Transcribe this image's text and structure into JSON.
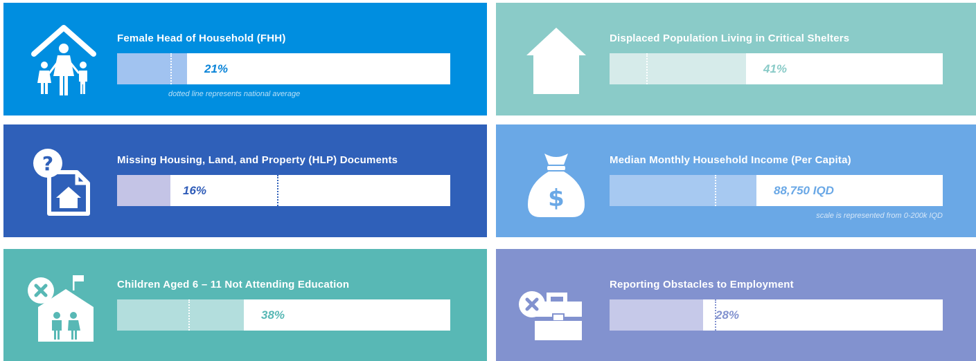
{
  "cards": [
    {
      "title": "Female Head of Household (FHH)",
      "value_label": "21%",
      "value_fraction": 0.21,
      "national_average_fraction": 0.16,
      "note": "dotted line represents national average",
      "icon": "family-home-icon",
      "background": "#008ee0",
      "fill_color": "#a1c3f0",
      "value_color": "#0a84d8"
    },
    {
      "title": "Displaced Population Living in Critical Shelters",
      "value_label": "41%",
      "value_fraction": 0.41,
      "national_average_fraction": 0.11,
      "icon": "house-icon",
      "background": "#8acbc8",
      "fill_color": "#d6ebea",
      "value_color": "#8acbc8"
    },
    {
      "title": "Missing Housing, Land, and Property (HLP) Documents",
      "value_label": "16%",
      "value_fraction": 0.16,
      "national_average_fraction": 0.48,
      "icon": "missing-document-icon",
      "background": "#2f60b9",
      "fill_color": "#c4c4e6",
      "value_color": "#2f5cb8"
    },
    {
      "title": "Median Monthly Household Income (Per Capita)",
      "value_label": "88,750 IQD",
      "value_fraction": 0.44,
      "national_average_fraction": 0.315,
      "note": "scale is represented from 0-200k IQD",
      "icon": "money-bag-icon",
      "background": "#6aa8e6",
      "fill_color": "#a7c9f1",
      "value_color": "#6aa8e6"
    },
    {
      "title": "Children Aged 6 – 11 Not Attending Education",
      "value_label": "38%",
      "value_fraction": 0.38,
      "national_average_fraction": 0.215,
      "icon": "children-school-icon",
      "background": "#58b8b5",
      "fill_color": "#b3dedd",
      "value_color": "#58b8b5"
    },
    {
      "title": "Reporting Obstacles to Employment",
      "value_label": "28%",
      "value_fraction": 0.28,
      "national_average_fraction": 0.315,
      "icon": "briefcase-icon",
      "background": "#8292cf",
      "fill_color": "#c6c9e9",
      "value_color": "#8292cf"
    }
  ]
}
